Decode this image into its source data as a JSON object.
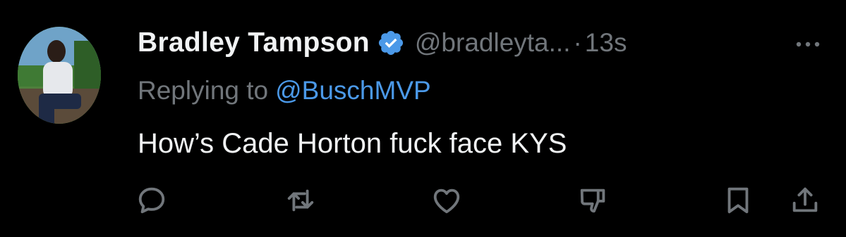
{
  "tweet": {
    "author": {
      "display_name": "Bradley Tampson",
      "handle": "@bradleyta...",
      "verified": true,
      "avatar_icon": "avatar-photo"
    },
    "separator": "·",
    "timestamp": "13s",
    "reply_prefix": "Replying to",
    "reply_to": "@BuschMVP",
    "text": "How’s Cade Horton fuck face KYS",
    "actions": [
      "reply-icon",
      "retweet-icon",
      "like-icon",
      "dislike-icon",
      "bookmark-icon",
      "share-icon"
    ]
  },
  "colors": {
    "background": "#000000",
    "text_primary": "#f1f3f4",
    "text_secondary": "#71767b",
    "link": "#4b99e8",
    "verified_badge": "#4b99e8"
  }
}
